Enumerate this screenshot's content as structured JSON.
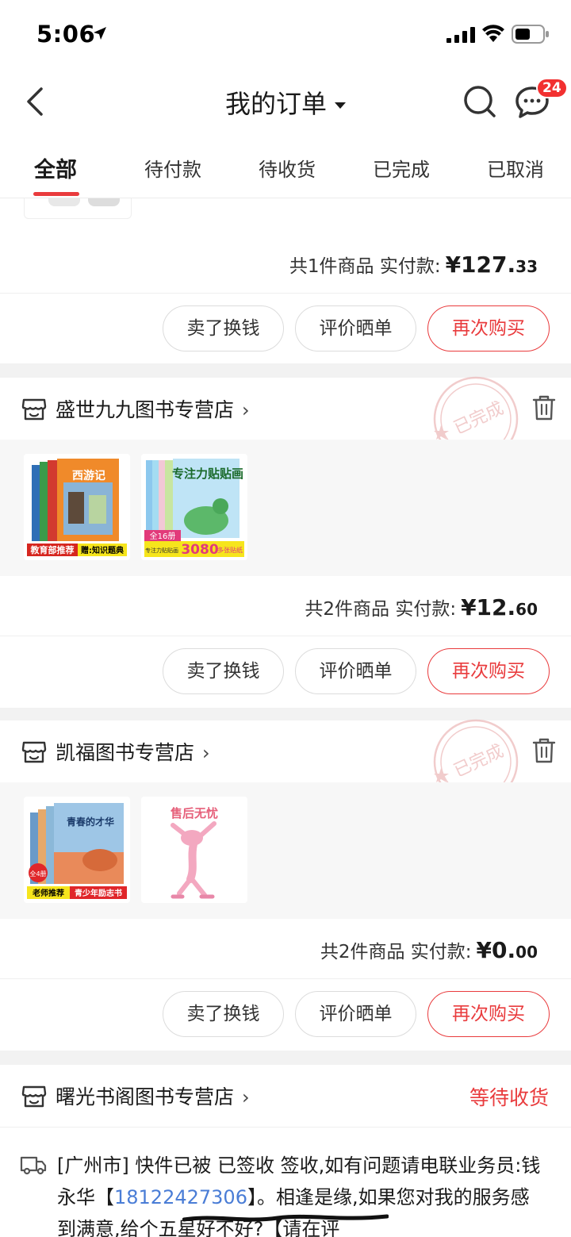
{
  "status_bar": {
    "time": "5:06"
  },
  "nav": {
    "title": "我的订单",
    "badge": "24"
  },
  "tabs": [
    {
      "label": "全部"
    },
    {
      "label": "待付款"
    },
    {
      "label": "待收货"
    },
    {
      "label": "已完成"
    },
    {
      "label": "已取消"
    }
  ],
  "orders": [
    {
      "total": {
        "count_text": "共1件商品",
        "paid_label": "实付款:",
        "yen": "¥127.",
        "decimal": "33"
      },
      "buttons": {
        "sell": "卖了换钱",
        "review": "评价晒单",
        "rebuy": "再次购买"
      }
    },
    {
      "shop": "盛世九九图书专营店",
      "stamp": "已完成",
      "products": [
        {
          "name": "西游记",
          "banner_left": "教育部推荐",
          "banner_right": "赠:知识题典"
        },
        {
          "name": "专注力贴贴画",
          "badge": "全16册",
          "count": "3080",
          "sub": "专注力贴贴画",
          "count_label": "多张贴纸"
        }
      ],
      "total": {
        "count_text": "共2件商品",
        "paid_label": "实付款:",
        "yen": "¥12.",
        "decimal": "60"
      },
      "buttons": {
        "sell": "卖了换钱",
        "review": "评价晒单",
        "rebuy": "再次购买"
      }
    },
    {
      "shop": "凯福图书专营店",
      "stamp": "已完成",
      "products": [
        {
          "name": "青春的才华",
          "badge": "全4册",
          "banner_left": "老师推荐",
          "banner_right": "青少年励志书"
        },
        {
          "name": "售后无忧"
        }
      ],
      "total": {
        "count_text": "共2件商品",
        "paid_label": "实付款:",
        "yen": "¥0.",
        "decimal": "00"
      },
      "buttons": {
        "sell": "卖了换钱",
        "review": "评价晒单",
        "rebuy": "再次购买"
      }
    },
    {
      "shop": "曙光书阁图书专营店",
      "status": "等待收货",
      "logistics": {
        "text_before": "[广州市] 快件已被  已签收 签收,如有问题请电联业务员:钱永华【",
        "phone": "18122427306",
        "text_after": "】。相逢是缘,如果您对我的服务感到满意,给个五星好不好?【请在评"
      }
    }
  ],
  "colors": {
    "accent": "#e93b3d",
    "link": "#4a7dd6",
    "badge": "#f23030"
  }
}
